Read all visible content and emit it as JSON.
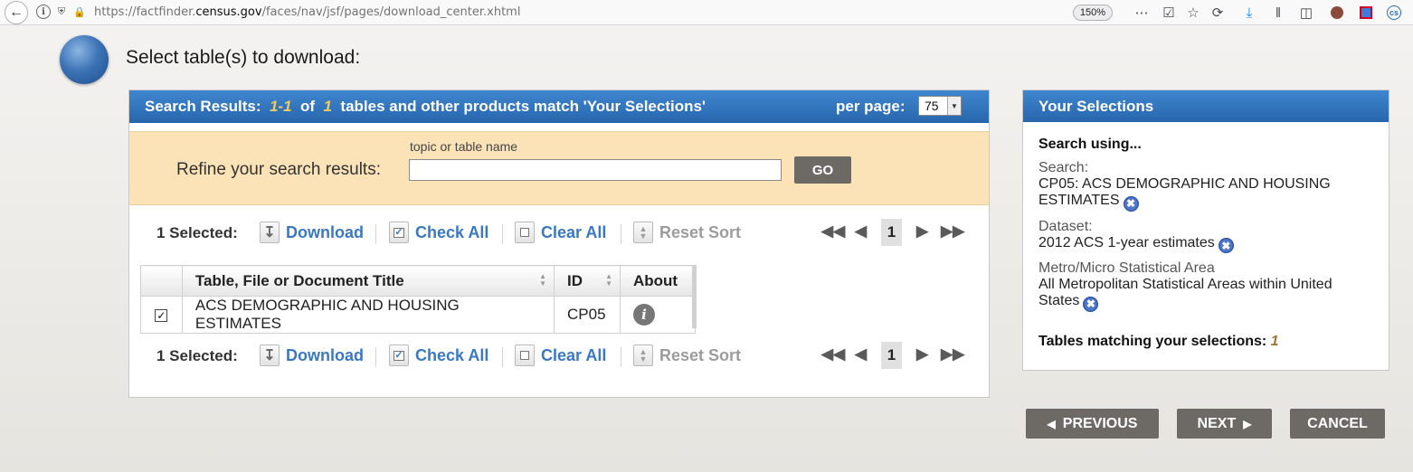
{
  "browser": {
    "url_prefix": "https://factfinder.",
    "url_domain": "census.gov",
    "url_path": "/faces/nav/jsf/pages/download_center.xhtml",
    "zoom": "150%"
  },
  "page": {
    "title": "Select table(s) to download:"
  },
  "results": {
    "header_label": "Search Results:",
    "range": "1-1",
    "of_label": "of",
    "total": "1",
    "match_text": "tables and other products match 'Your Selections'",
    "per_page_label": "per page:",
    "per_page_value": "75"
  },
  "refine": {
    "label": "Refine your search results:",
    "hint": "topic or table name",
    "input_value": "",
    "go_label": "GO"
  },
  "actions": {
    "selected_label": "1 Selected:",
    "download_label": "Download",
    "check_all_label": "Check All",
    "clear_all_label": "Clear All",
    "reset_sort_label": "Reset Sort",
    "current_page": "1"
  },
  "table": {
    "columns": [
      "Table, File or Document Title",
      "ID",
      "About"
    ],
    "rows": [
      {
        "checked": true,
        "title": "ACS DEMOGRAPHIC AND HOUSING ESTIMATES",
        "id": "CP05"
      }
    ]
  },
  "selections": {
    "header": "Your Selections",
    "search_using": "Search using...",
    "items": [
      {
        "label": "Search:",
        "value": "CP05: ACS DEMOGRAPHIC AND HOUSING ESTIMATES"
      },
      {
        "label": "Dataset:",
        "value": "2012 ACS 1-year estimates"
      },
      {
        "label": "Metro/Micro Statistical Area",
        "value": "All Metropolitan Statistical Areas within United States"
      }
    ],
    "matching_label": "Tables matching your selections:",
    "matching_count": "1"
  },
  "nav": {
    "previous": "PREVIOUS",
    "next": "NEXT",
    "cancel": "CANCEL"
  },
  "colors": {
    "header_blue": "#2f72bd",
    "link_blue": "#3a78c2",
    "refine_bg": "#fbe3b7",
    "button_gray": "#6d6a66",
    "accent_gold": "#f4c95d"
  }
}
